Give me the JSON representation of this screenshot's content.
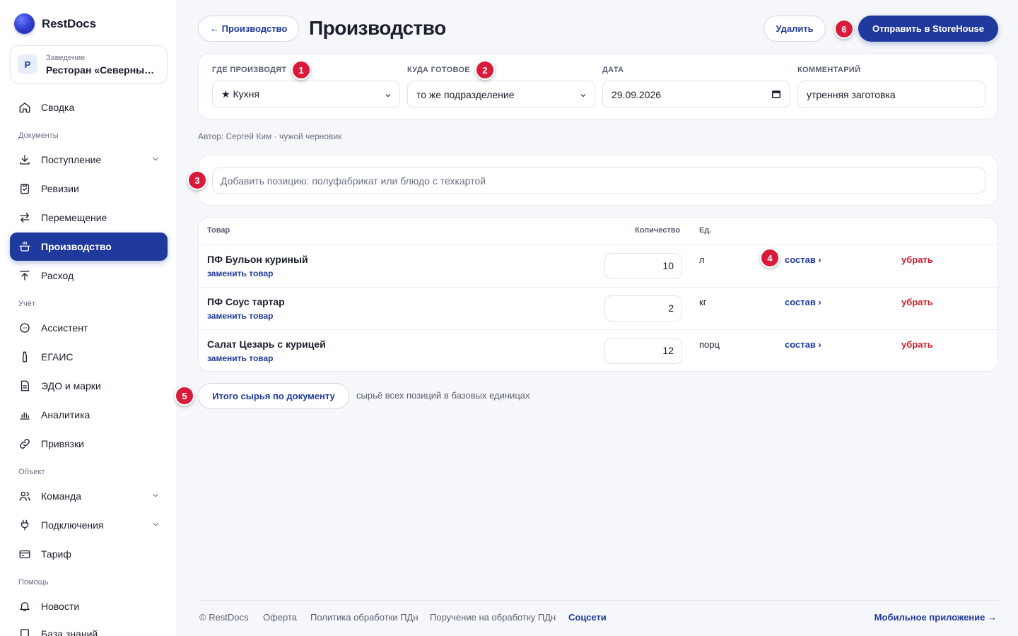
{
  "brand": {
    "name": "RestDocs"
  },
  "venue": {
    "avatar": "Р",
    "caption": "Заведение",
    "name": "Ресторан «Северный ..."
  },
  "sidebar": {
    "items": [
      {
        "label": "Сводка"
      },
      {
        "group": "Документы"
      },
      {
        "label": "Поступление"
      },
      {
        "label": "Ревизии"
      },
      {
        "label": "Перемещение"
      },
      {
        "label": "Производство"
      },
      {
        "label": "Расход"
      },
      {
        "group": "Учёт"
      },
      {
        "label": "Ассистент"
      },
      {
        "label": "ЕГАИС"
      },
      {
        "label": "ЭДО и марки"
      },
      {
        "label": "Аналитика"
      },
      {
        "label": "Привязки"
      },
      {
        "group": "Объект"
      },
      {
        "label": "Команда"
      },
      {
        "label": "Подключения"
      },
      {
        "label": "Тариф"
      },
      {
        "group": "Помощь"
      },
      {
        "label": "Новости"
      },
      {
        "label": "База знаний"
      }
    ]
  },
  "header": {
    "back_label": "← Производство",
    "title": "Производство",
    "delete_label": "Удалить",
    "send_label": "Отправить в StoreHouse"
  },
  "badges": [
    "1",
    "2",
    "3",
    "4",
    "5",
    "6"
  ],
  "form": {
    "where_label": "ГДЕ ПРОИЗВОДЯТ",
    "where_value": "★ Кухня",
    "dest_label": "КУДА ГОТОВОЕ",
    "dest_value": "то же подразделение",
    "date_label": "ДАТА",
    "date_value": "29.09.2026",
    "comment_label": "КОММЕНТАРИЙ",
    "comment_value": "утренняя заготовка"
  },
  "author": "Автор: Сергей Ким · чужой черновик",
  "search": {
    "placeholder": "Добавить позицию: полуфабрикат или блюдо с техкартой"
  },
  "table": {
    "columns": [
      "Товар",
      "Количество",
      "Ед."
    ],
    "rows": [
      {
        "name": "ПФ Бульон куриный",
        "replace": "заменить товар",
        "qty": "10",
        "unit": "л",
        "compose": "состав ›",
        "remove": "убрать"
      },
      {
        "name": "ПФ Соус тартар",
        "replace": "заменить товар",
        "qty": "2",
        "unit": "кг",
        "compose": "состав ›",
        "remove": "убрать"
      },
      {
        "name": "Салат Цезарь с курицей",
        "replace": "заменить товар",
        "qty": "12",
        "unit": "порц",
        "compose": "состав ›",
        "remove": "убрать"
      }
    ]
  },
  "totals": {
    "button": "Итого сырья по документу",
    "hint": "сырьё всех позиций в базовых единицах"
  },
  "footer": {
    "copyright": "© RestDocs",
    "offer": "Оферта",
    "policy": "Политика обработки ПДн",
    "instruction": "Поручение на обработку ПДн",
    "social": "Соцсети",
    "mobile": "Мобильное приложение →"
  },
  "colors": {
    "accent": "#1f3a9c",
    "danger": "#cc1f2f",
    "badge": "#d81b3a"
  }
}
